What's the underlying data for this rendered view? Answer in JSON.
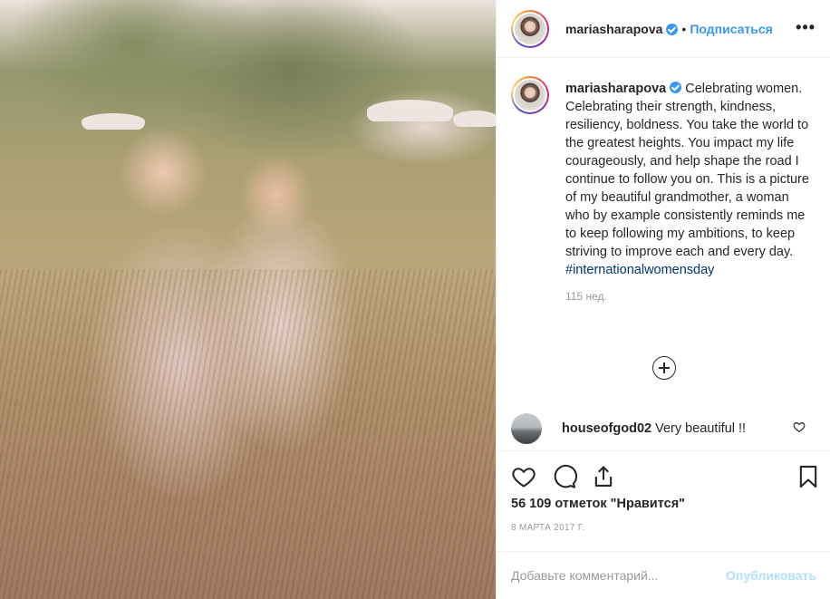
{
  "post": {
    "image_alt": "Photo of a woman holding a young girl in a field of flowers",
    "author": {
      "username": "mariasharapova",
      "verified": true
    },
    "header": {
      "separator": "•",
      "follow_label": "Подписаться",
      "more_label": "•••"
    },
    "caption": {
      "username": "mariasharapova",
      "text": "Celebrating women. Celebrating their strength, kindness, resiliency, boldness. You take the world to the greatest heights. You impact my life courageously, and help shape the road I continue to follow you on. This is a picture of my beautiful grandmother, a woman who by example consistently reminds me to keep following my ambitions, to keep striving to improve each and every day.",
      "hashtag": "#internationalwomensday",
      "time_ago": "115 нед."
    },
    "comments": [
      {
        "username": "houseofgod02",
        "text": "Very beautiful !!"
      }
    ],
    "likes_text": "56 109 отметок \"Нравится\"",
    "date": "8 марта 2017 г.",
    "add_comment": {
      "placeholder": "Добавьте комментарий...",
      "publish_label": "Опубликовать"
    }
  },
  "icons": {
    "like": "heart-icon",
    "comment": "comment-icon",
    "share": "share-icon",
    "save": "bookmark-icon",
    "load_more": "plus-circle-icon",
    "comment_like": "small-heart-icon"
  },
  "colors": {
    "link": "#3897f0",
    "hashtag": "#003569",
    "muted": "#999999",
    "publish_disabled": "#b2dffc"
  }
}
